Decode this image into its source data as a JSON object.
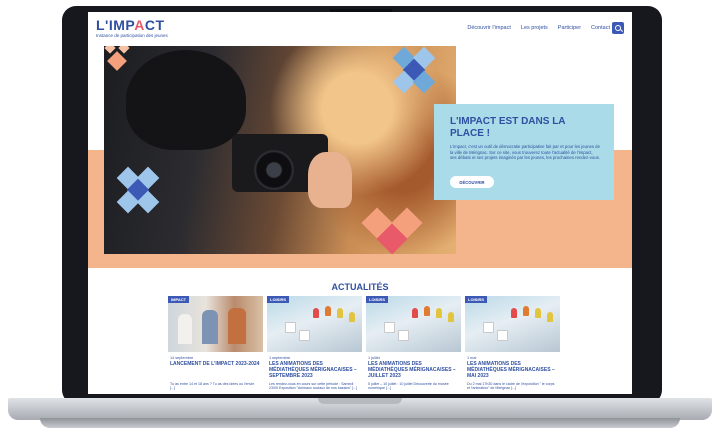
{
  "site": {
    "logo": "L'IMPACT",
    "tagline": "Instance de participation des jeunes",
    "nav": [
      "Découvrir l'impact",
      "Les projets",
      "Participer",
      "Contact"
    ]
  },
  "hero": {
    "title": "L'IMPACT EST DANS LA PLACE !",
    "description": "L'impact, c'est un outil de démocratie participative fait par et pour les jeunes de la ville de Mérignac. Sur ce site, vous trouverez toute l'actualité de l'impact, ses débats et ses projets imaginés par les jeunes, les prochaines rendez-vous.",
    "cta": "DÉCOUVRIR"
  },
  "news": {
    "title": "ACTUALITÉS",
    "cards": [
      {
        "tag": "IMPACT",
        "date": "14 septembre",
        "title": "LANCEMENT DE L'IMPACT 2023-2024",
        "excerpt": "Tu as entre 14 et 18 ans ? Tu as des idées ou l'envie [...]"
      },
      {
        "tag": "LOISIRS",
        "date": "1 septembre",
        "title": "LES ANIMATIONS DES MÉDIATHÈQUES MÉRIGNACAISES – SEPTEMBRE 2023",
        "excerpt": "Les rendez-vous en cours sur cette période : Samedi 23/09 Exposition \"Animaux sociaux de nos bassins\" [...]"
      },
      {
        "tag": "LOISIRS",
        "date": "1 juillet",
        "title": "LES ANIMATIONS DES MÉDIATHÈQUES MÉRIGNACAISES – JUILLET 2023",
        "excerpt": "5 juillet – 10 juillet : 10 juillet Découverte du musée numérique [...]"
      },
      {
        "tag": "LOISIRS",
        "date": "1 mai",
        "title": "LES ANIMATIONS DES MÉDIATHÈQUES MÉRIGNACAISES – MAI 2023",
        "excerpt": "Du 2 mai 17h30 dans le cadre de l'exposition \" le corps et l'animation\" de Mérignac [...]"
      }
    ]
  },
  "colors": {
    "brand_blue": "#2f4fa0",
    "accent_pink": "#e85a6a",
    "peach": "#f5b58c",
    "light_blue": "#a9dbe8"
  }
}
